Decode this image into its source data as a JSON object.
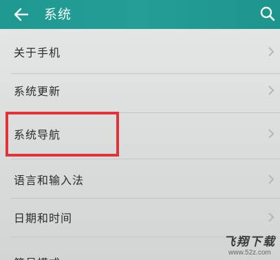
{
  "header": {
    "title": "系统",
    "back_icon": "arrow-left-icon",
    "search_icon": "search-icon"
  },
  "menu": {
    "items": [
      {
        "label": "关于手机"
      },
      {
        "label": "系统更新"
      },
      {
        "label": "系统导航"
      },
      {
        "label": "语言和输入法"
      },
      {
        "label": "日期和时间"
      },
      {
        "label": "简易模式"
      }
    ],
    "highlighted_item": "系统导航",
    "chevron_icon": "chevron-right-icon"
  },
  "watermark": {
    "text": "飞翔下载",
    "url": "www.52z.com"
  },
  "colors": {
    "appbar": "#219a92",
    "background": "#dcdedd",
    "highlight": "#e0323a"
  }
}
